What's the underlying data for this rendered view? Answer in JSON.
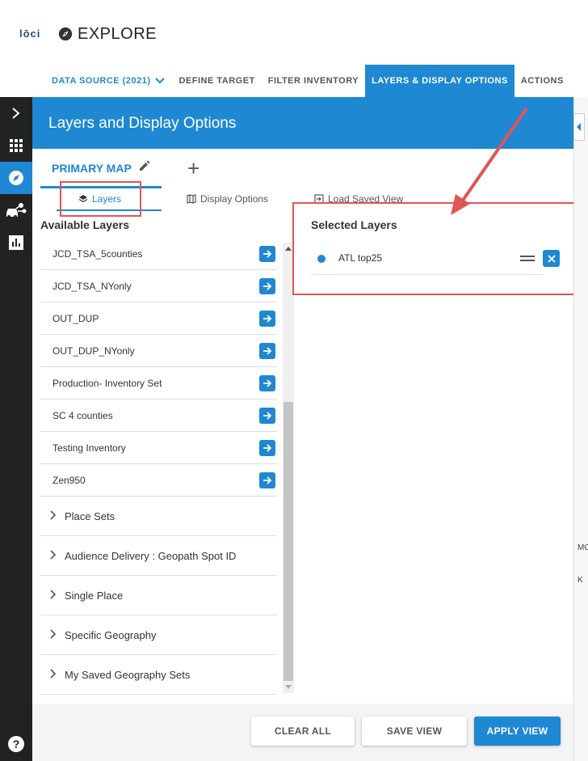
{
  "header": {
    "logo": "lōci",
    "title": "EXPLORE"
  },
  "nav": {
    "source": "DATA SOURCE (2021)",
    "items": [
      "DEFINE TARGET",
      "FILTER INVENTORY",
      "LAYERS & DISPLAY OPTIONS",
      "ACTIONS"
    ]
  },
  "panel": {
    "title": "Layers and Display Options",
    "primary_tab": "PRIMARY MAP",
    "subtabs": [
      "Layers",
      "Display Options",
      "Load Saved View"
    ],
    "available_title": "Available Layers",
    "layers": [
      "JCD_TSA_5counties",
      "JCD_TSA_NYonly",
      "OUT_DUP",
      "OUT_DUP_NYonly",
      "Production- Inventory Set",
      "SC 4 counties",
      "Testing Inventory",
      "Zen950"
    ],
    "groups": [
      "Place Sets",
      "Audience Delivery : Geopath Spot ID",
      "Single Place",
      "Specific Geography",
      "My Saved Geography Sets"
    ],
    "selected_title": "Selected Layers",
    "selected": [
      "ATL top25"
    ]
  },
  "footer": {
    "clear": "CLEAR ALL",
    "save": "SAVE VIEW",
    "apply": "APPLY VIEW"
  },
  "map": {
    "label1": "MO",
    "label2": "K"
  },
  "colors": {
    "accent": "#1e88d2",
    "highlight": "#e05555",
    "rail": "#222222"
  }
}
